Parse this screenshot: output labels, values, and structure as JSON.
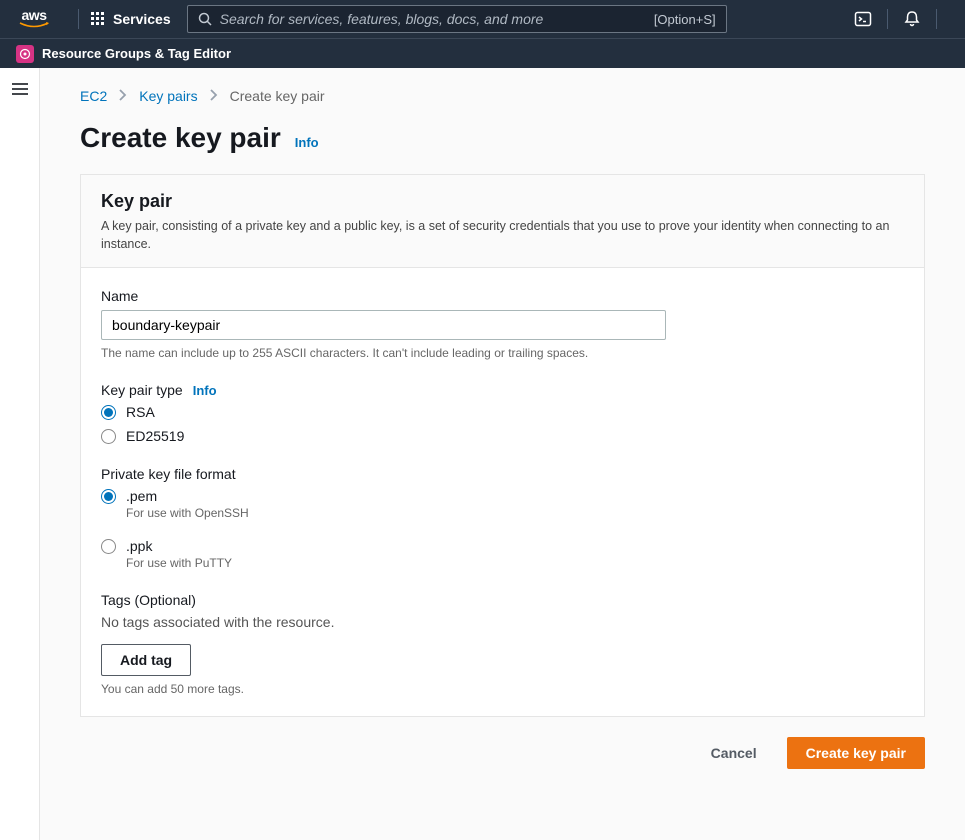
{
  "topnav": {
    "services_label": "Services",
    "search_placeholder": "Search for services, features, blogs, docs, and more",
    "search_hint": "[Option+S]"
  },
  "subnav": {
    "label": "Resource Groups & Tag Editor"
  },
  "breadcrumb": {
    "items": [
      "EC2",
      "Key pairs",
      "Create key pair"
    ]
  },
  "heading": {
    "title": "Create key pair",
    "info": "Info"
  },
  "panel": {
    "title": "Key pair",
    "description": "A key pair, consisting of a private key and a public key, is a set of security credentials that you use to prove your identity when connecting to an instance."
  },
  "form": {
    "name_label": "Name",
    "name_value": "boundary-keypair",
    "name_hint": "The name can include up to 255 ASCII characters. It can't include leading or trailing spaces.",
    "type_label": "Key pair type",
    "type_info": "Info",
    "type_options": [
      {
        "label": "RSA",
        "checked": true
      },
      {
        "label": "ED25519",
        "checked": false
      }
    ],
    "format_label": "Private key file format",
    "format_options": [
      {
        "label": ".pem",
        "sub": "For use with OpenSSH",
        "checked": true
      },
      {
        "label": ".ppk",
        "sub": "For use with PuTTY",
        "checked": false
      }
    ],
    "tags_label": "Tags (Optional)",
    "tags_empty": "No tags associated with the resource.",
    "add_tag_label": "Add tag",
    "tags_hint": "You can add 50 more tags."
  },
  "actions": {
    "cancel": "Cancel",
    "submit": "Create key pair"
  }
}
